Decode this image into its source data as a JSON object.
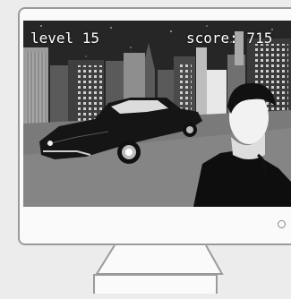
{
  "hud": {
    "level_text": "level 15",
    "score_text": "score: 715"
  },
  "icons": [
    "power-led-icon"
  ],
  "colors": {
    "hud_text": "#ffffff",
    "monitor_frame": "#9a9a9a",
    "monitor_body": "#fafafa",
    "background": "#ececec"
  }
}
